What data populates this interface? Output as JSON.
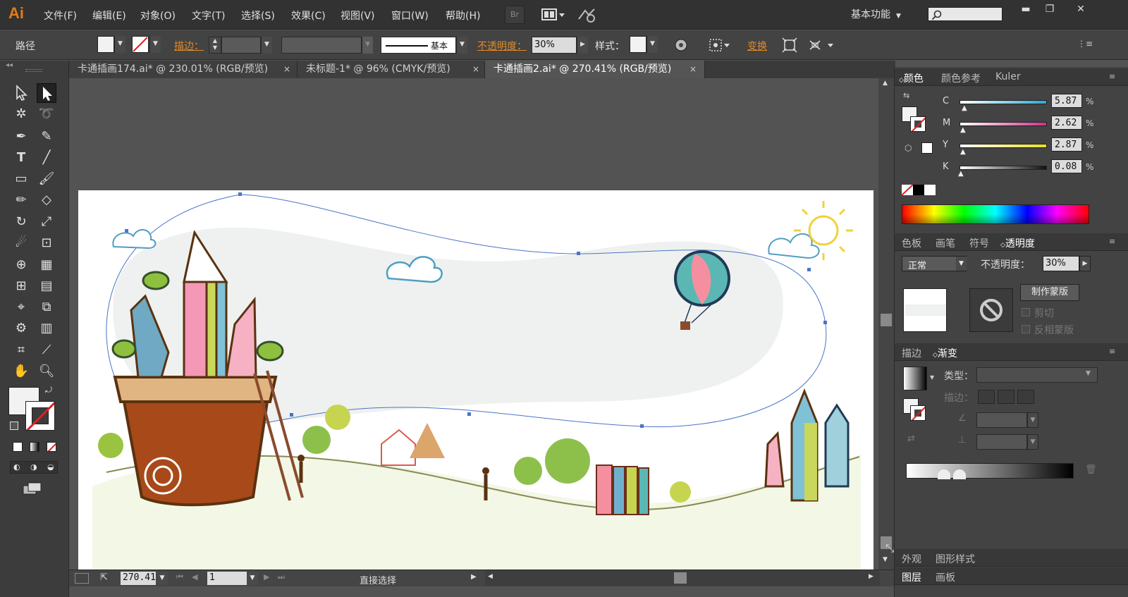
{
  "app": {
    "logo": "Ai",
    "workspace": "基本功能",
    "bridge_label": "Br"
  },
  "menus": [
    "文件(F)",
    "编辑(E)",
    "对象(O)",
    "文字(T)",
    "选择(S)",
    "效果(C)",
    "视图(V)",
    "窗口(W)",
    "帮助(H)"
  ],
  "window_controls": {
    "minimize": "▬",
    "maximize": "❐",
    "close": "✕"
  },
  "control_bar": {
    "selection_type": "路径",
    "stroke_label": "描边：",
    "brush_label": "基本",
    "opacity_label": "不透明度：",
    "opacity_value": "30%",
    "style_label": "样式：",
    "transform_label": "变换"
  },
  "tabs": [
    {
      "label": "卡通插画174.ai* @ 230.01% (RGB/预览)",
      "active": false
    },
    {
      "label": "未标题-1* @ 96% (CMYK/预览)",
      "active": false
    },
    {
      "label": "卡通插画2.ai* @ 270.41% (RGB/预览)",
      "active": true
    }
  ],
  "tab_close": "×",
  "status": {
    "zoom": "270.41",
    "page": "1",
    "tool": "直接选择"
  },
  "color_panel": {
    "tabs": [
      "颜色",
      "颜色参考",
      "Kuler"
    ],
    "channels": [
      {
        "label": "C",
        "value": "5.87",
        "color": "#2aa9d8"
      },
      {
        "label": "M",
        "value": "2.62",
        "color": "#d0308c"
      },
      {
        "label": "Y",
        "value": "2.87",
        "color": "#e8e020"
      },
      {
        "label": "K",
        "value": "0.08",
        "color": "#111111"
      }
    ],
    "percent": "%"
  },
  "swatch_panel": {
    "tabs": [
      "色板",
      "画笔",
      "符号",
      "透明度"
    ]
  },
  "transparency": {
    "blend_mode": "正常",
    "opacity_label": "不透明度：",
    "opacity_value": "30%",
    "make_mask": "制作蒙版",
    "clip": "剪切",
    "invert": "反相蒙版"
  },
  "gradient_panel": {
    "tabs": [
      "描边",
      "渐变"
    ],
    "type_label": "类型：",
    "stroke_label": "描边："
  },
  "bottom_tabs": {
    "row1": [
      "外观",
      "图形样式"
    ],
    "row2": [
      "图层",
      "画板"
    ]
  },
  "colors": {
    "accent_orange": "#e08a2a",
    "ui_dark": "#323232",
    "ui_panel": "#434343"
  }
}
